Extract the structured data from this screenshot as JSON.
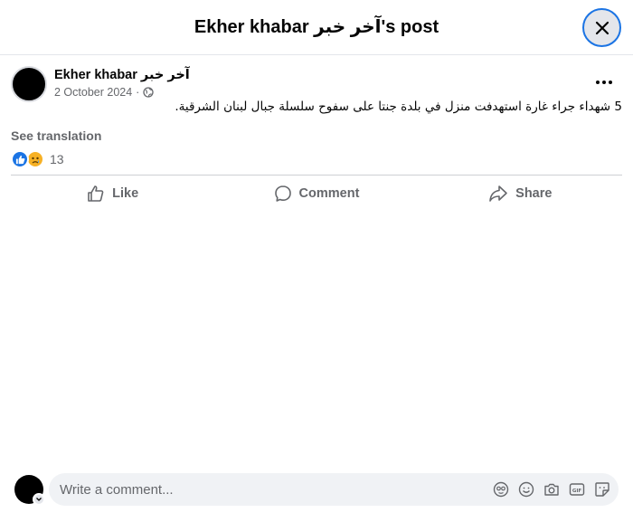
{
  "modal": {
    "title": "Ekher khabar آخر خبر's post"
  },
  "post": {
    "author": "Ekher khabar آخر خبر",
    "date": "2 October 2024",
    "date_separator": "·",
    "audience_icon": "globe-icon",
    "text": "5 شهداء جراء غارة استهدفت منزل في بلدة جنتا على سفوح سلسلة جبال لبنان الشرقية.",
    "see_translation": "See translation"
  },
  "reactions": {
    "types": [
      "like",
      "sad"
    ],
    "count": "13"
  },
  "actions": {
    "like": "Like",
    "comment": "Comment",
    "share": "Share"
  },
  "comment_box": {
    "placeholder": "Write a comment...",
    "icons": [
      "avatar-sticker-icon",
      "emoji-icon",
      "camera-icon",
      "gif-icon",
      "sticker-icon"
    ]
  },
  "colors": {
    "accent": "#1b74e4",
    "secondary_text": "#65676b",
    "primary_text": "#050505",
    "input_bg": "#f0f2f5"
  }
}
